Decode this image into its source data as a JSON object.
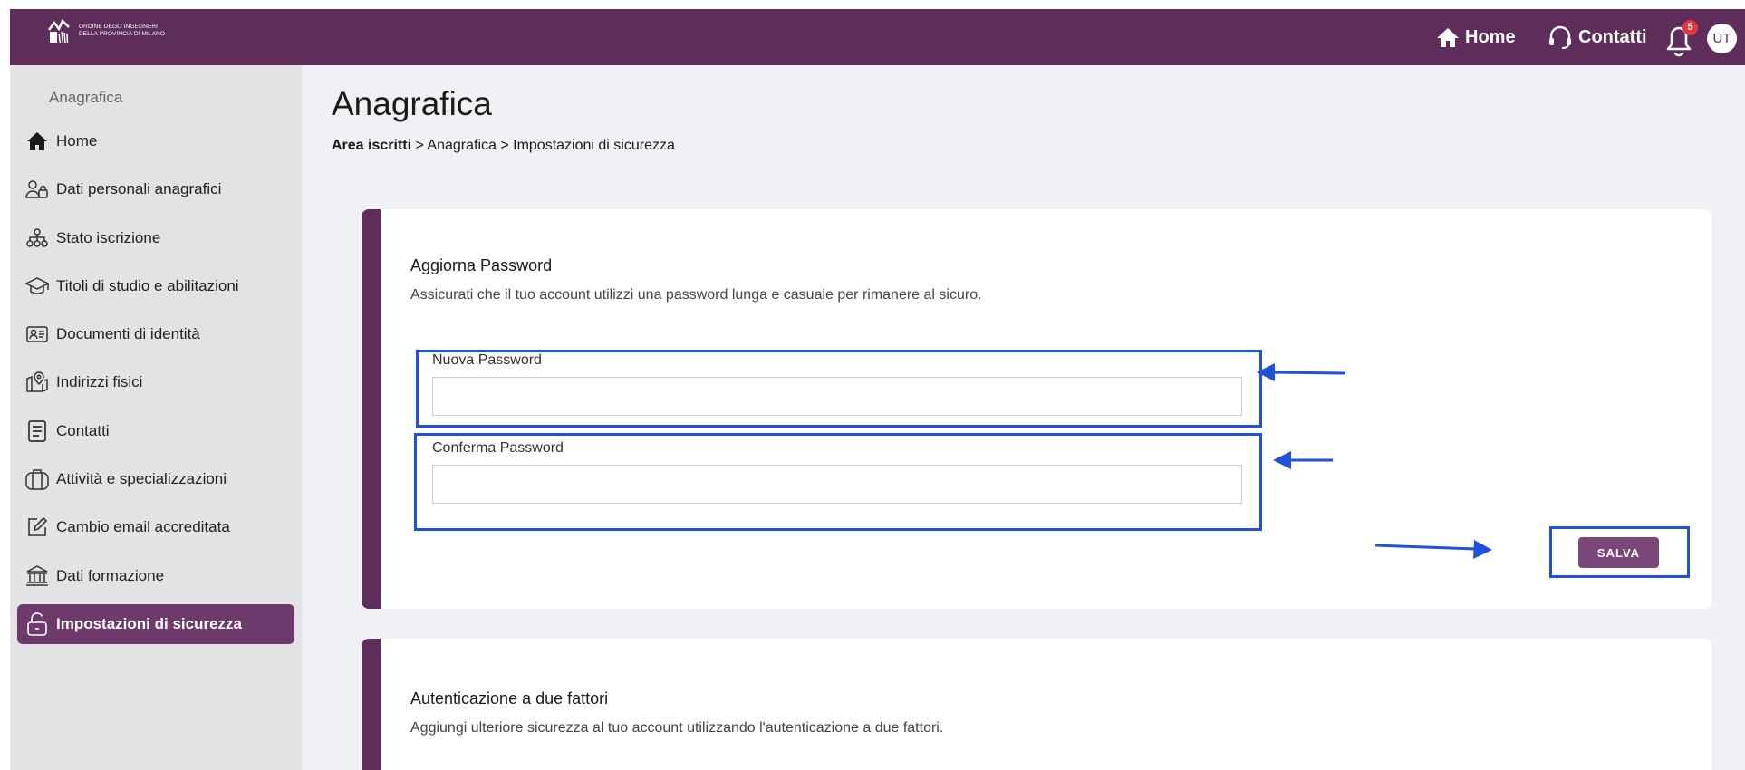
{
  "header": {
    "logo_line1": "ORDINE DEGLI INGEGNERI",
    "logo_line2": "DELLA PROVINCIA DI MILANO",
    "home_label": "Home",
    "contatti_label": "Contatti",
    "notification_count": "5",
    "avatar_initials": "UT"
  },
  "sidebar": {
    "title": "Anagrafica",
    "items": [
      {
        "label": "Home",
        "icon": "home-icon"
      },
      {
        "label": "Dati personali anagrafici",
        "icon": "users-icon"
      },
      {
        "label": "Stato iscrizione",
        "icon": "hierarchy-icon"
      },
      {
        "label": "Titoli di studio e abilitazioni",
        "icon": "graduation-cap-icon"
      },
      {
        "label": "Documenti di identità",
        "icon": "id-card-icon"
      },
      {
        "label": "Indirizzi fisici",
        "icon": "map-pin-icon"
      },
      {
        "label": "Contatti",
        "icon": "document-icon"
      },
      {
        "label": "Attività e specializzazioni",
        "icon": "briefcase-icon"
      },
      {
        "label": "Cambio email accreditata",
        "icon": "edit-icon"
      },
      {
        "label": "Dati formazione",
        "icon": "institution-icon"
      },
      {
        "label": "Impostazioni di sicurezza",
        "icon": "lock-icon",
        "active": true
      }
    ]
  },
  "main": {
    "title": "Anagrafica",
    "breadcrumb": {
      "root": "Area iscritti",
      "rest": " > Anagrafica > Impostazioni di sicurezza"
    },
    "password_card": {
      "title": "Aggiorna Password",
      "description": "Assicurati che il tuo account utilizzi una password lunga e casuale per rimanere al sicuro.",
      "new_password_label": "Nuova Password",
      "new_password_value": "",
      "confirm_password_label": "Conferma Password",
      "confirm_password_value": "",
      "save_label": "SALVA"
    },
    "twofa_card": {
      "title": "Autenticazione a due fattori",
      "description": "Aggiungi ulteriore sicurezza al tuo account utilizzando l'autenticazione a due fattori."
    }
  },
  "colors": {
    "brand": "#5e2d5c",
    "button": "#7a4778",
    "annotation": "#1f52d8",
    "badge": "#e5383b"
  }
}
